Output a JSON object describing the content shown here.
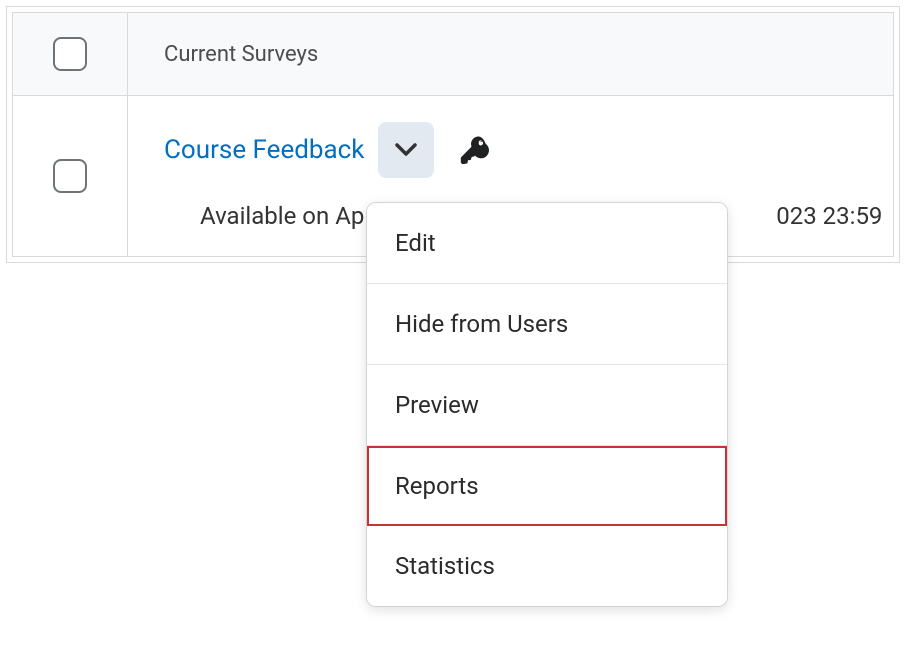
{
  "table": {
    "header": "Current Surveys",
    "row": {
      "title": "Course Feedback",
      "availability_prefix": "Available on Ap",
      "availability_suffix": "023 23:59"
    }
  },
  "menu": {
    "items": [
      {
        "label": "Edit",
        "highlighted": false
      },
      {
        "label": "Hide from Users",
        "highlighted": false
      },
      {
        "label": "Preview",
        "highlighted": false
      },
      {
        "label": "Reports",
        "highlighted": true
      },
      {
        "label": "Statistics",
        "highlighted": false
      }
    ]
  }
}
